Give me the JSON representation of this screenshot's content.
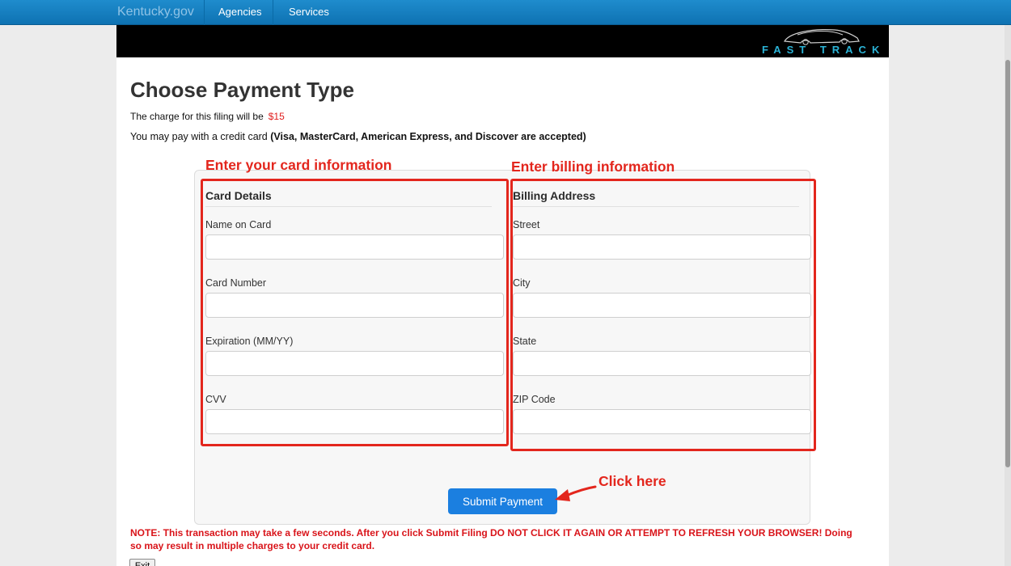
{
  "nav": {
    "brand": "Kentucky.gov",
    "links": [
      "Agencies",
      "Services"
    ]
  },
  "banner": {
    "logo_text": "FAST TRACK"
  },
  "page": {
    "title": "Choose Payment Type",
    "charge_label": "The charge for this filing will be",
    "charge_amount": "$15",
    "pay_with_prefix": "You may pay with a credit card",
    "pay_with_cards": "(Visa, MasterCard, American Express, and Discover are accepted)"
  },
  "card_details": {
    "title": "Card Details",
    "fields": [
      {
        "label": "Name on Card",
        "value": ""
      },
      {
        "label": "Card Number",
        "value": ""
      },
      {
        "label": "Expiration (MM/YY)",
        "value": ""
      },
      {
        "label": "CVV",
        "value": ""
      }
    ]
  },
  "billing": {
    "title": "Billing Address",
    "fields": [
      {
        "label": "Street",
        "value": ""
      },
      {
        "label": "City",
        "value": ""
      },
      {
        "label": "State",
        "value": ""
      },
      {
        "label": "ZIP Code",
        "value": ""
      }
    ]
  },
  "submit_label": "Submit Payment",
  "annotations": {
    "card": "Enter your card information",
    "billing": "Enter billing information",
    "submit": "Click here",
    "color": "#e3261d"
  },
  "note": "NOTE: This transaction may take a few seconds. After you click Submit Filing DO NOT CLICK IT AGAIN OR ATTEMPT TO REFRESH YOUR BROWSER! Doing so may result in multiple charges to your credit card.",
  "exit_label": "Exit",
  "colors": {
    "nav_blue": "#0e72b2",
    "button_blue": "#1b7fe0",
    "alert_red": "#d9141a"
  }
}
